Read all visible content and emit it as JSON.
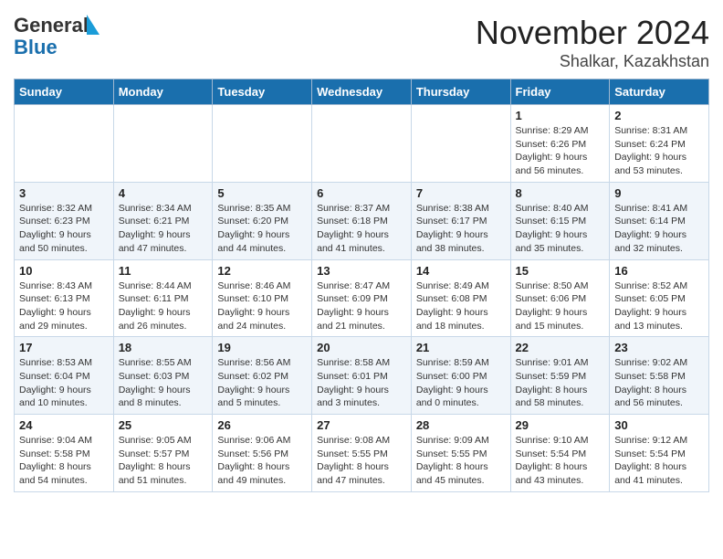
{
  "header": {
    "logo_line1": "General",
    "logo_line2": "Blue",
    "title": "November 2024",
    "subtitle": "Shalkar, Kazakhstan"
  },
  "weekdays": [
    "Sunday",
    "Monday",
    "Tuesday",
    "Wednesday",
    "Thursday",
    "Friday",
    "Saturday"
  ],
  "weeks": [
    [
      {
        "day": "",
        "detail": ""
      },
      {
        "day": "",
        "detail": ""
      },
      {
        "day": "",
        "detail": ""
      },
      {
        "day": "",
        "detail": ""
      },
      {
        "day": "",
        "detail": ""
      },
      {
        "day": "1",
        "detail": "Sunrise: 8:29 AM\nSunset: 6:26 PM\nDaylight: 9 hours and 56 minutes."
      },
      {
        "day": "2",
        "detail": "Sunrise: 8:31 AM\nSunset: 6:24 PM\nDaylight: 9 hours and 53 minutes."
      }
    ],
    [
      {
        "day": "3",
        "detail": "Sunrise: 8:32 AM\nSunset: 6:23 PM\nDaylight: 9 hours and 50 minutes."
      },
      {
        "day": "4",
        "detail": "Sunrise: 8:34 AM\nSunset: 6:21 PM\nDaylight: 9 hours and 47 minutes."
      },
      {
        "day": "5",
        "detail": "Sunrise: 8:35 AM\nSunset: 6:20 PM\nDaylight: 9 hours and 44 minutes."
      },
      {
        "day": "6",
        "detail": "Sunrise: 8:37 AM\nSunset: 6:18 PM\nDaylight: 9 hours and 41 minutes."
      },
      {
        "day": "7",
        "detail": "Sunrise: 8:38 AM\nSunset: 6:17 PM\nDaylight: 9 hours and 38 minutes."
      },
      {
        "day": "8",
        "detail": "Sunrise: 8:40 AM\nSunset: 6:15 PM\nDaylight: 9 hours and 35 minutes."
      },
      {
        "day": "9",
        "detail": "Sunrise: 8:41 AM\nSunset: 6:14 PM\nDaylight: 9 hours and 32 minutes."
      }
    ],
    [
      {
        "day": "10",
        "detail": "Sunrise: 8:43 AM\nSunset: 6:13 PM\nDaylight: 9 hours and 29 minutes."
      },
      {
        "day": "11",
        "detail": "Sunrise: 8:44 AM\nSunset: 6:11 PM\nDaylight: 9 hours and 26 minutes."
      },
      {
        "day": "12",
        "detail": "Sunrise: 8:46 AM\nSunset: 6:10 PM\nDaylight: 9 hours and 24 minutes."
      },
      {
        "day": "13",
        "detail": "Sunrise: 8:47 AM\nSunset: 6:09 PM\nDaylight: 9 hours and 21 minutes."
      },
      {
        "day": "14",
        "detail": "Sunrise: 8:49 AM\nSunset: 6:08 PM\nDaylight: 9 hours and 18 minutes."
      },
      {
        "day": "15",
        "detail": "Sunrise: 8:50 AM\nSunset: 6:06 PM\nDaylight: 9 hours and 15 minutes."
      },
      {
        "day": "16",
        "detail": "Sunrise: 8:52 AM\nSunset: 6:05 PM\nDaylight: 9 hours and 13 minutes."
      }
    ],
    [
      {
        "day": "17",
        "detail": "Sunrise: 8:53 AM\nSunset: 6:04 PM\nDaylight: 9 hours and 10 minutes."
      },
      {
        "day": "18",
        "detail": "Sunrise: 8:55 AM\nSunset: 6:03 PM\nDaylight: 9 hours and 8 minutes."
      },
      {
        "day": "19",
        "detail": "Sunrise: 8:56 AM\nSunset: 6:02 PM\nDaylight: 9 hours and 5 minutes."
      },
      {
        "day": "20",
        "detail": "Sunrise: 8:58 AM\nSunset: 6:01 PM\nDaylight: 9 hours and 3 minutes."
      },
      {
        "day": "21",
        "detail": "Sunrise: 8:59 AM\nSunset: 6:00 PM\nDaylight: 9 hours and 0 minutes."
      },
      {
        "day": "22",
        "detail": "Sunrise: 9:01 AM\nSunset: 5:59 PM\nDaylight: 8 hours and 58 minutes."
      },
      {
        "day": "23",
        "detail": "Sunrise: 9:02 AM\nSunset: 5:58 PM\nDaylight: 8 hours and 56 minutes."
      }
    ],
    [
      {
        "day": "24",
        "detail": "Sunrise: 9:04 AM\nSunset: 5:58 PM\nDaylight: 8 hours and 54 minutes."
      },
      {
        "day": "25",
        "detail": "Sunrise: 9:05 AM\nSunset: 5:57 PM\nDaylight: 8 hours and 51 minutes."
      },
      {
        "day": "26",
        "detail": "Sunrise: 9:06 AM\nSunset: 5:56 PM\nDaylight: 8 hours and 49 minutes."
      },
      {
        "day": "27",
        "detail": "Sunrise: 9:08 AM\nSunset: 5:55 PM\nDaylight: 8 hours and 47 minutes."
      },
      {
        "day": "28",
        "detail": "Sunrise: 9:09 AM\nSunset: 5:55 PM\nDaylight: 8 hours and 45 minutes."
      },
      {
        "day": "29",
        "detail": "Sunrise: 9:10 AM\nSunset: 5:54 PM\nDaylight: 8 hours and 43 minutes."
      },
      {
        "day": "30",
        "detail": "Sunrise: 9:12 AM\nSunset: 5:54 PM\nDaylight: 8 hours and 41 minutes."
      }
    ]
  ]
}
